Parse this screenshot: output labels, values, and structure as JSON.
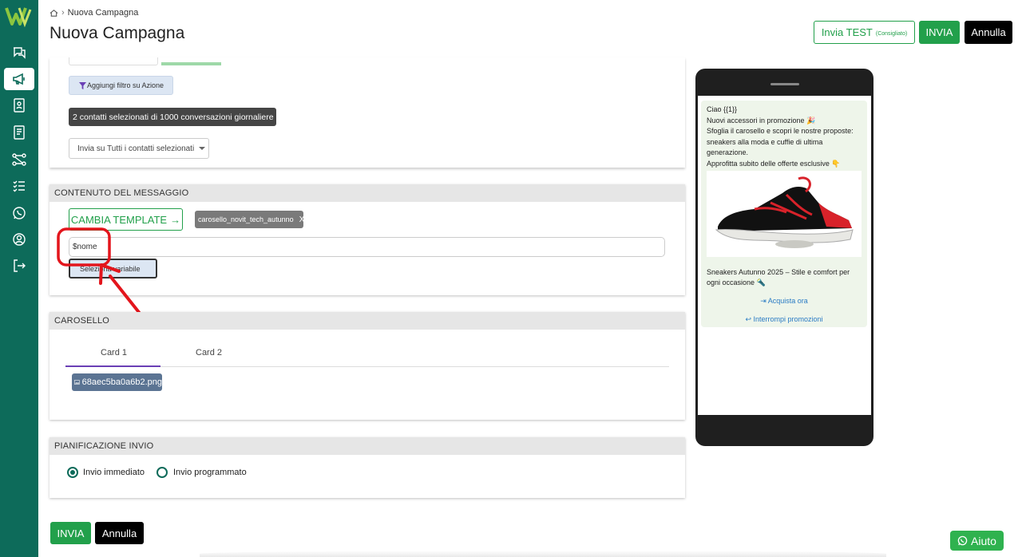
{
  "breadcrumb": {
    "current": "Nuova Campagna"
  },
  "page": {
    "title": "Nuova Campagna"
  },
  "header": {
    "test_label": "Invia TEST",
    "test_note": "(Consigliato)",
    "send_label": "INVIA",
    "cancel_label": "Annulla"
  },
  "filters": {
    "add_action_filter": "Aggiungi filtro su Azione",
    "selected_info": "2 contatti selezionati di 1000 conversazioni giornaliere",
    "send_to": "Invia su Tutti i contatti selezionati"
  },
  "message": {
    "section_title": "CONTENUTO DEL MESSAGGIO",
    "change_template": "CAMBIA TEMPLATE",
    "template_name": "carosello_novit_tech_autunno",
    "template_remove": "X",
    "variable_value": "$nome",
    "select_variable": "Seleziona variabile"
  },
  "carousel": {
    "section_title": "CAROSELLO",
    "tabs": [
      "Card 1",
      "Card 2"
    ],
    "active_tab": "Card 1",
    "file": "68aec5ba0a6b2.png"
  },
  "schedule": {
    "section_title": "PIANIFICAZIONE INVIO",
    "options": [
      "Invio immediato",
      "Invio programmato"
    ],
    "selected": "Invio immediato"
  },
  "footer": {
    "send_label": "INVIA",
    "cancel_label": "Annulla"
  },
  "preview": {
    "lines": [
      "Ciao {{1}}",
      "Nuovi accessori in promozione 🎉",
      "Sfoglia il carosello e scopri le nostre proposte: sneakers alla moda e cuffie di ultima generazione.",
      "Approfitta subito delle offerte esclusive 👇"
    ],
    "card_text": "Sneakers Autunno 2025 – Stile e comfort per ogni occasione 🔦",
    "button_buy": "Acquista ora",
    "button_stop": "Interrompi promozioni"
  },
  "help": {
    "label": "Aiuto"
  },
  "colors": {
    "brand": "#0d6b5a",
    "accent": "#22a04b",
    "annotation": "#e3151c"
  }
}
